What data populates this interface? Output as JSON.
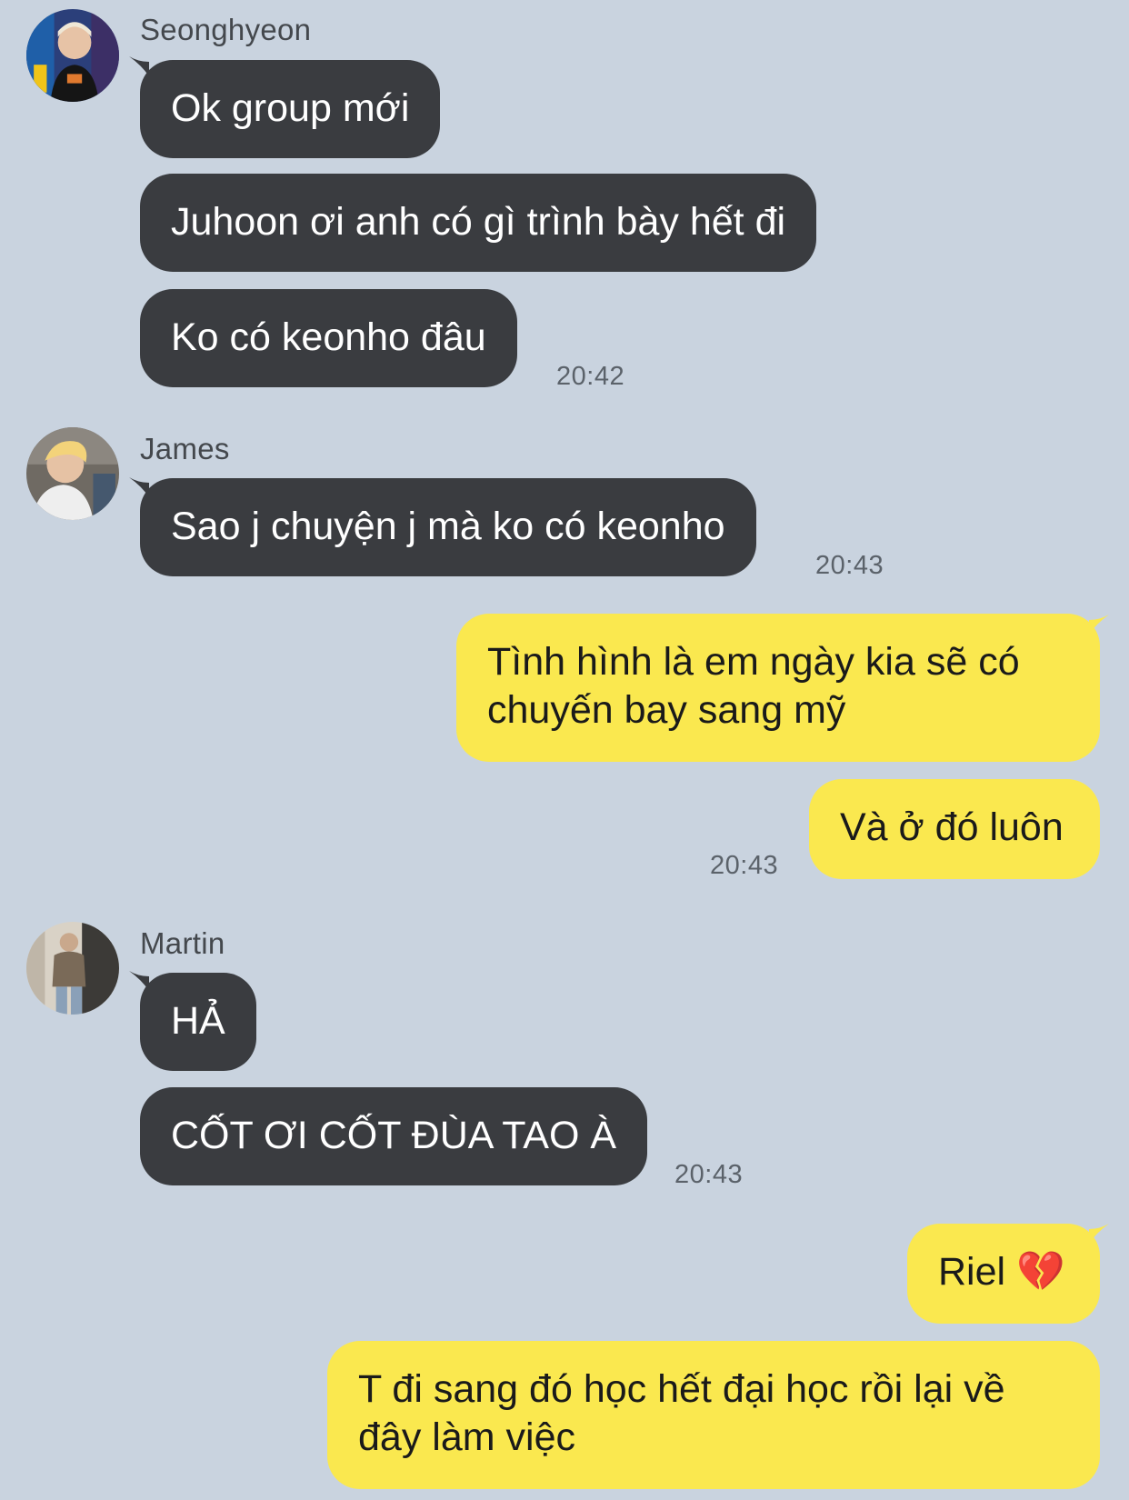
{
  "colors": {
    "background": "#c9d3df",
    "incoming_bubble": "#3a3c40",
    "outgoing_bubble": "#fae84f"
  },
  "groups": [
    {
      "sender": "Seonghyeon",
      "avatar": "user-avatar-photo",
      "messages": [
        "Ok group mới",
        "Juhoon ơi anh có gì trình bày hết đi",
        "Ko có keonho đâu"
      ],
      "time": "20:42"
    },
    {
      "sender": "James",
      "avatar": "user-avatar-photo",
      "messages": [
        "Sao j chuyện j mà ko có keonho"
      ],
      "time": "20:43"
    },
    {
      "sender": "me",
      "messages": [
        "Tình hình là em ngày kia sẽ có chuyến bay sang mỹ",
        "Và ở đó luôn"
      ],
      "time": "20:43"
    },
    {
      "sender": "Martin",
      "avatar": "user-avatar-photo",
      "messages": [
        "HẢ",
        "CỐT ƠI CỐT ĐÙA TAO À"
      ],
      "time": "20:43"
    },
    {
      "sender": "me",
      "messages": [
        "Riel 💔",
        "T đi sang đó học hết đại học rồi lại về đây làm việc"
      ]
    }
  ]
}
